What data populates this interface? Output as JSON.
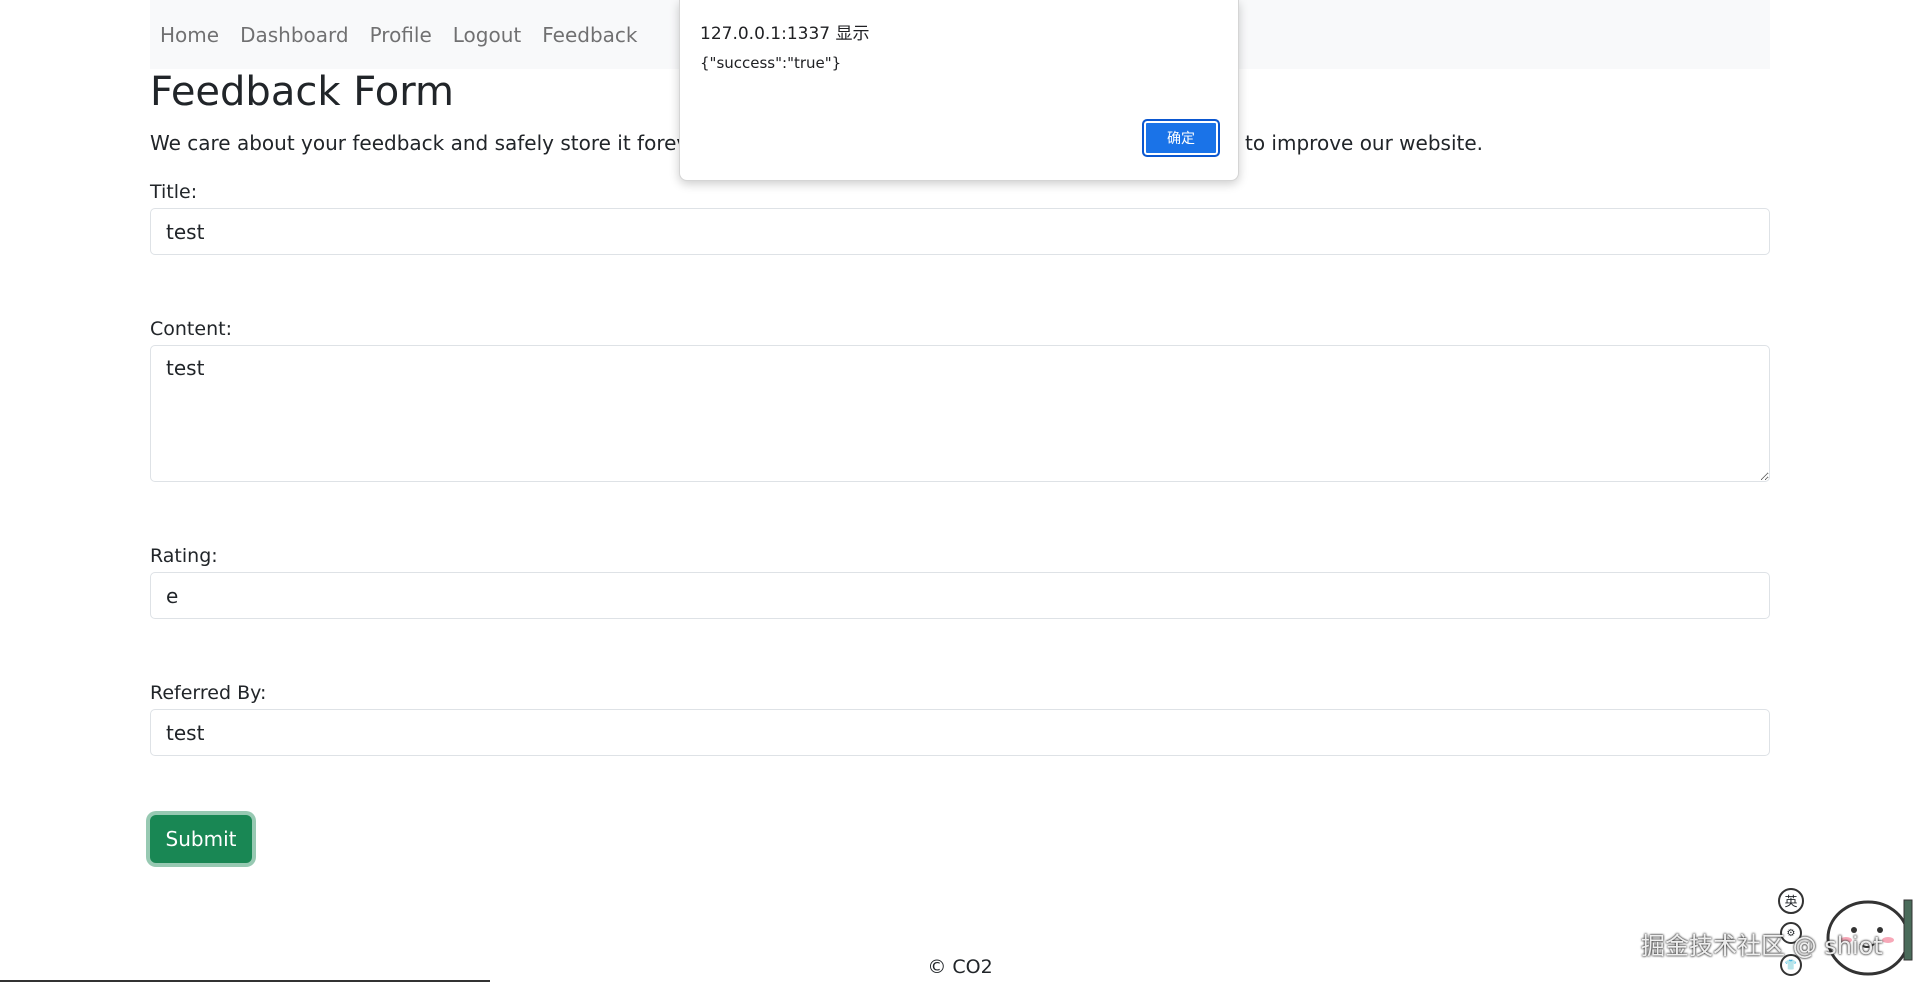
{
  "nav": {
    "items": [
      {
        "label": "Home"
      },
      {
        "label": "Dashboard"
      },
      {
        "label": "Profile"
      },
      {
        "label": "Logout"
      },
      {
        "label": "Feedback"
      }
    ]
  },
  "page": {
    "title": "Feedback Form",
    "intro": "We care about your feedback and safely store it forever",
    "intro_tail": "to improve our website."
  },
  "form": {
    "title_label": "Title:",
    "title_value": "test",
    "content_label": "Content:",
    "content_value": "test",
    "rating_label": "Rating:",
    "rating_value": "e",
    "referred_label": "Referred By:",
    "referred_value": "test",
    "submit_label": "Submit"
  },
  "footer": {
    "text": "© CO2"
  },
  "alert": {
    "origin": "127.0.0.1:1337 显示",
    "message": "{\"success\":\"true\"}",
    "ok_label": "确定"
  },
  "watermark": {
    "text": "掘金技术社区 @ shiot",
    "ime_label": "英"
  },
  "colors": {
    "submit": "#198754",
    "alert_button": "#1a73e8",
    "navbar_bg": "#f8f9fa"
  }
}
